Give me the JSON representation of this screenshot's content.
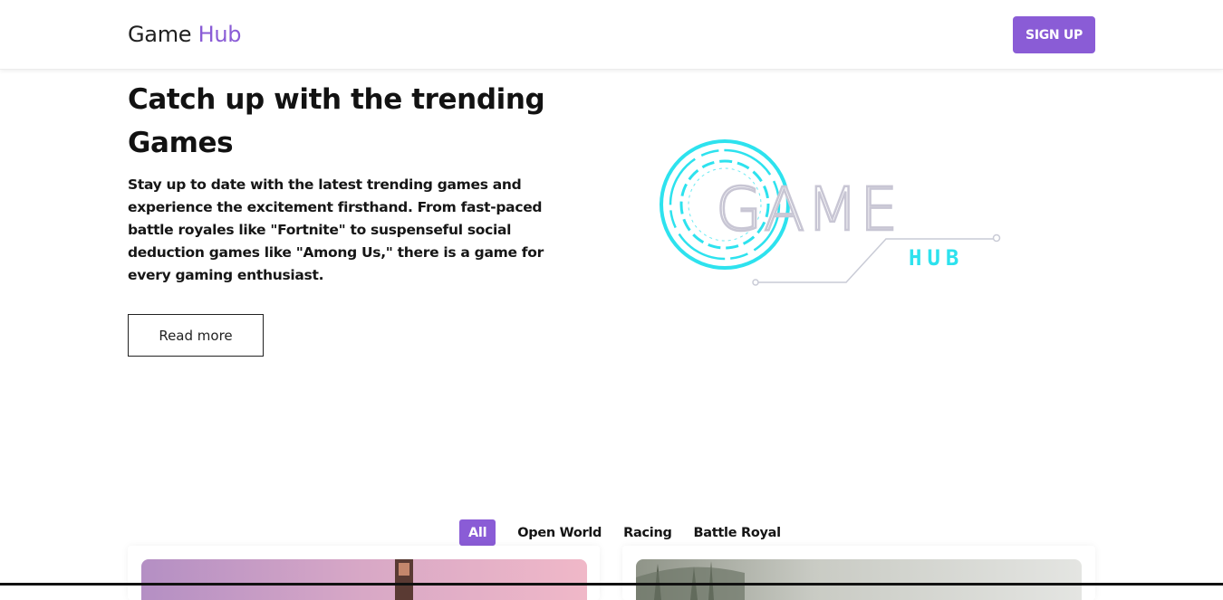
{
  "nav": {
    "brand_main": "Game",
    "brand_accent": "Hub",
    "signup_label": "SIGN UP"
  },
  "hero": {
    "title": "Catch up with the trending Games",
    "description": "Stay up to date with the latest trending games and experience the excitement firsthand. From fast-paced battle royales like \"Fortnite\" to suspenseful social deduction games like \"Among Us,\" there is a game for every gaming enthusiast.",
    "read_more_label": "Read more",
    "logo_word": "GAME",
    "logo_sub": "HUB"
  },
  "filters": {
    "items": [
      "All",
      "Open World",
      "Racing",
      "Battle Royal"
    ],
    "active": "All"
  },
  "colors": {
    "accent": "#8a5cd6",
    "logo_cyan": "#2de2ee"
  }
}
